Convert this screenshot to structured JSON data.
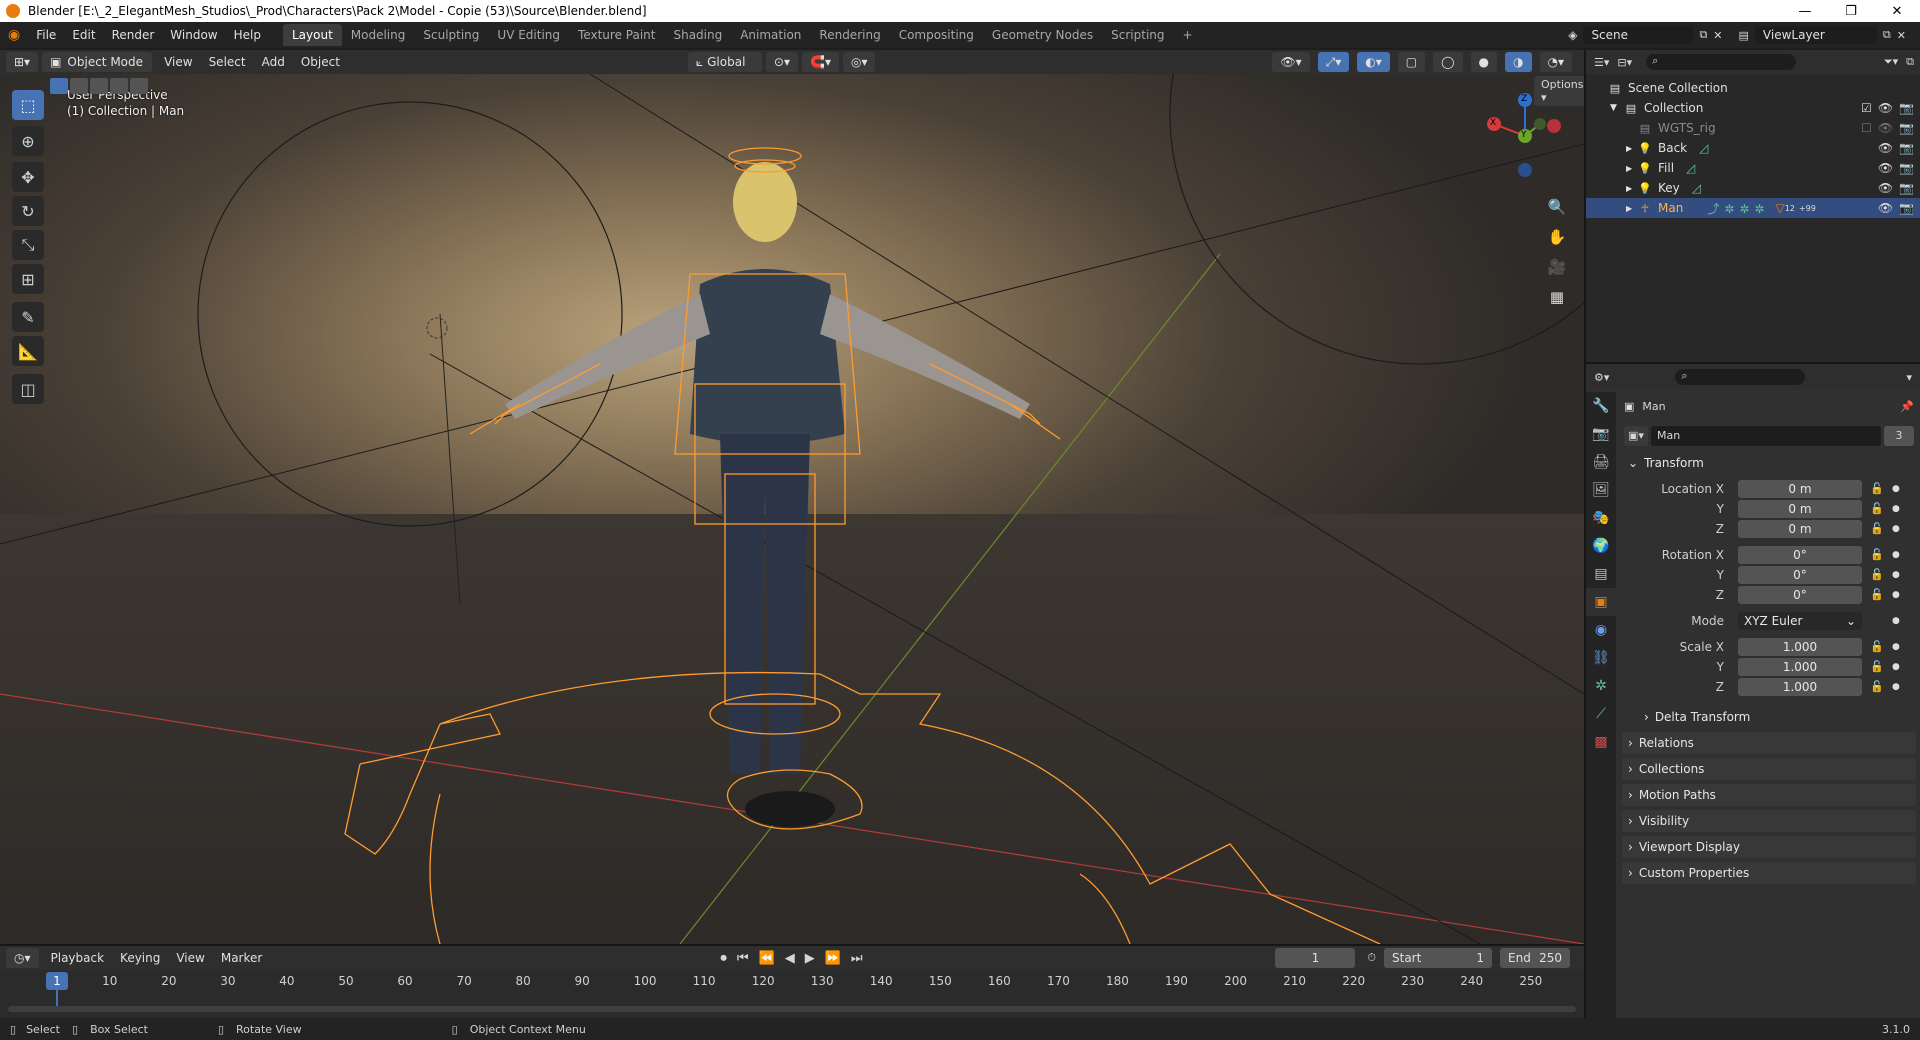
{
  "window": {
    "title": "Blender [E:\\_2_ElegantMesh_Studios\\_Prod\\Characters\\Pack 2\\Model - Copie (53)\\Source\\Blender.blend]",
    "minimize": "—",
    "maximize": "❐",
    "close": "✕"
  },
  "menus": [
    "File",
    "Edit",
    "Render",
    "Window",
    "Help"
  ],
  "workspaces": [
    "Layout",
    "Modeling",
    "Sculpting",
    "UV Editing",
    "Texture Paint",
    "Shading",
    "Animation",
    "Rendering",
    "Compositing",
    "Geometry Nodes",
    "Scripting"
  ],
  "active_workspace": "Layout",
  "add_workspace": "+",
  "scene": "Scene",
  "view_layer": "ViewLayer",
  "viewport": {
    "mode": "Object Mode",
    "menus": [
      "View",
      "Select",
      "Add",
      "Object"
    ],
    "orientation": "Global",
    "options": "Options",
    "overlay_line1": "User Perspective",
    "overlay_line2": "(1) Collection | Man",
    "gizmo": {
      "x": "X",
      "y": "Y",
      "z": "Z"
    }
  },
  "outliner": {
    "root": "Scene Collection",
    "items": [
      {
        "name": "Collection",
        "type": "collection"
      },
      {
        "name": "WGTS_rig",
        "type": "collection-disabled"
      },
      {
        "name": "Back",
        "type": "light"
      },
      {
        "name": "Fill",
        "type": "light"
      },
      {
        "name": "Key",
        "type": "light"
      },
      {
        "name": "Man",
        "type": "armature",
        "selected": true,
        "badge": "12",
        "badge2": "+99"
      }
    ]
  },
  "properties": {
    "object_name": "Man",
    "datablock_name": "Man",
    "datablock_users": "3",
    "transform_title": "Transform",
    "location": {
      "label": "Location X",
      "x": "0 m",
      "y": "0 m",
      "z": "0 m"
    },
    "rotation": {
      "label": "Rotation X",
      "x": "0°",
      "y": "0°",
      "z": "0°"
    },
    "mode_label": "Mode",
    "mode_value": "XYZ Euler",
    "scale": {
      "label": "Scale X",
      "x": "1.000",
      "y": "1.000",
      "z": "1.000"
    },
    "axis_y": "Y",
    "axis_z": "Z",
    "delta": "Delta Transform",
    "panels": [
      "Relations",
      "Collections",
      "Motion Paths",
      "Visibility",
      "Viewport Display",
      "Custom Properties"
    ]
  },
  "timeline": {
    "menus": [
      "Playback",
      "Keying",
      "View",
      "Marker"
    ],
    "current_frame": "1",
    "start_label": "Start",
    "start": "1",
    "end_label": "End",
    "end": "250",
    "ticks": [
      "10",
      "20",
      "30",
      "40",
      "50",
      "60",
      "70",
      "80",
      "90",
      "100",
      "110",
      "120",
      "130",
      "140",
      "150",
      "160",
      "170",
      "180",
      "190",
      "200",
      "210",
      "220",
      "230",
      "240",
      "250"
    ],
    "playhead": "1"
  },
  "status": {
    "select": "Select",
    "box_select": "Box Select",
    "rotate": "Rotate View",
    "context": "Object Context Menu",
    "version": "3.1.0"
  },
  "colors": {
    "accent": "#4772b3",
    "selection": "#e87d0d",
    "rig": "#ff9b2f"
  }
}
